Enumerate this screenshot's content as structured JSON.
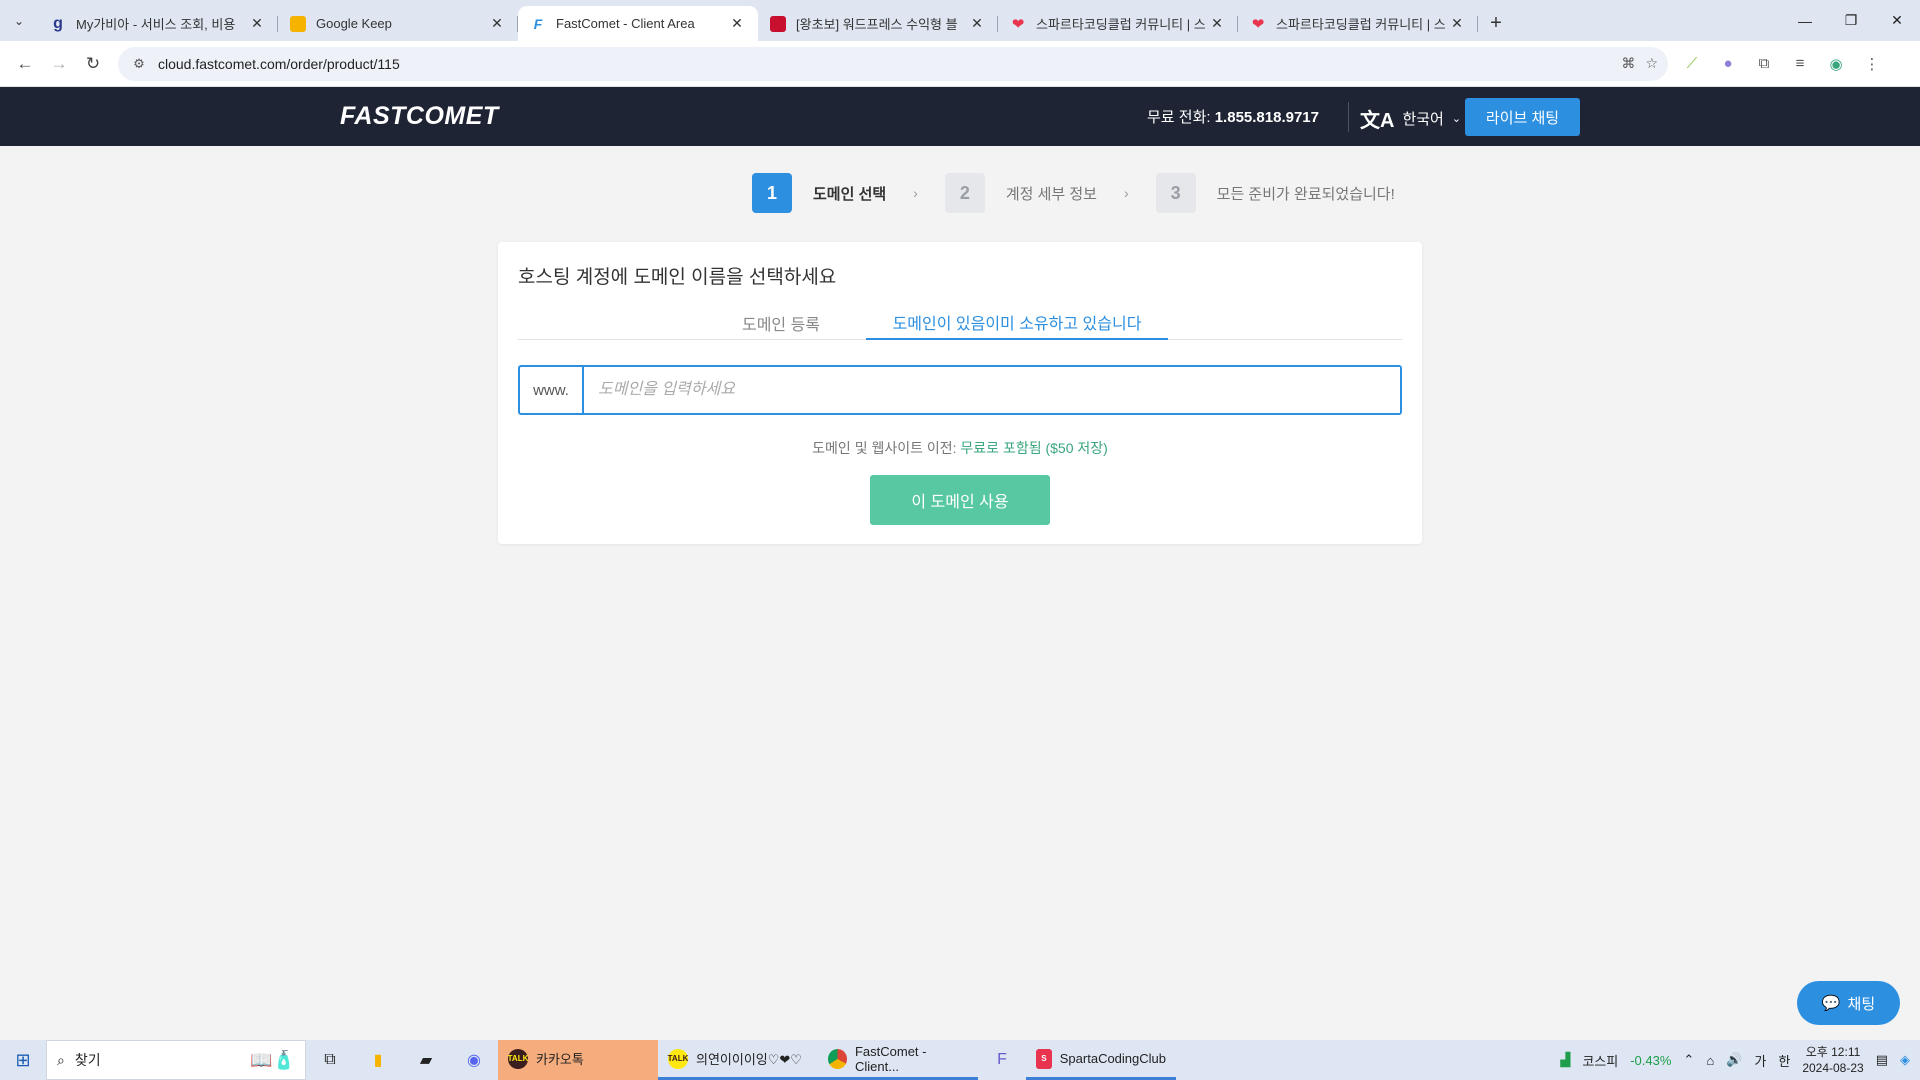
{
  "browser": {
    "tabs": [
      {
        "title": "My가비아 - 서비스 조회, 비용",
        "favicon_text": "g",
        "color": "#2b3a8c",
        "active": false
      },
      {
        "title": "Google Keep",
        "favicon_text": "",
        "color": "#f6b400",
        "active": false
      },
      {
        "title": "FastComet - Client Area",
        "favicon_text": "F",
        "color": "#2c8fe0",
        "active": true
      },
      {
        "title": "[왕초보] 워드프레스 수익형 블",
        "favicon_text": "",
        "color": "#c8102e",
        "active": false
      },
      {
        "title": "스파르타코딩클럽 커뮤니티 | 스",
        "favicon_text": "",
        "color": "#e8344e",
        "active": false
      },
      {
        "title": "스파르타코딩클럽 커뮤니티 | 스",
        "favicon_text": "",
        "color": "#e8344e",
        "active": false
      }
    ],
    "url": "cloud.fastcomet.com/order/product/115"
  },
  "header": {
    "logo": "FASTCOMET",
    "phone_label": "무료 전화:",
    "phone_number": "1.855.818.9717",
    "language": "한국어",
    "live_chat": "라이브 채팅"
  },
  "steps": [
    {
      "num": "1",
      "label": "도메인 선택",
      "active": true
    },
    {
      "num": "2",
      "label": "계정 세부 정보",
      "active": false
    },
    {
      "num": "3",
      "label": "모든 준비가 완료되었습니다!",
      "active": false
    }
  ],
  "card": {
    "title": "호스팅 계정에 도메인 이름을 선택하세요",
    "tab_register": "도메인 등록",
    "tab_owned": "도메인이 있음이미 소유하고 있습니다",
    "www_prefix": "www.",
    "input_placeholder": "도메인을 입력하세요",
    "transfer_label": "도메인 및 웹사이트 이전:",
    "transfer_free": "무료로 포함됨 ($50 저장)",
    "use_button": "이 도메인 사용"
  },
  "chat_widget": "채팅",
  "taskbar": {
    "search": "찾기",
    "apps": [
      {
        "label": "카카오톡",
        "icon": "TALK"
      },
      {
        "label": "의연이이이잉♡❤♡",
        "icon": "TALK"
      },
      {
        "label": "FastComet - Client...",
        "icon": "chrome"
      },
      {
        "label": "SpartaCodingClub",
        "icon": "sparta"
      }
    ],
    "kospi_label": "코스피",
    "kospi_value": "-0.43%",
    "ime": "가",
    "ime2": "한",
    "time": "오후 12:11",
    "date": "2024-08-23"
  },
  "colors": {
    "brand_blue": "#2c8fe0",
    "header_bg": "#1e2434",
    "green_button": "#58c8a3"
  }
}
